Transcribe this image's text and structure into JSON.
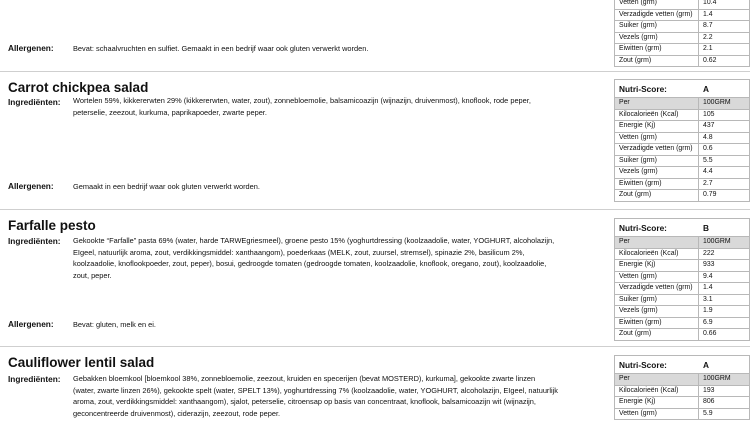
{
  "top_partial": {
    "allergen_label": "Allergenen:",
    "allergen_text": "Bevat: schaalvruchten en sulfiet. Gemaakt in een bedrijf waar ook gluten verwerkt worden.",
    "nutrition_rows": [
      [
        "Vetten (grm)",
        "10.4"
      ],
      [
        "Verzadigde vetten (grm)",
        "1.4"
      ],
      [
        "Suiker (grm)",
        "8.7"
      ],
      [
        "Vezels (grm)",
        "2.2"
      ],
      [
        "Eiwitten (grm)",
        "2.1"
      ],
      [
        "Zout (grm)",
        "0.62"
      ]
    ]
  },
  "products": [
    {
      "title": "Carrot chickpea salad",
      "ingredients_label": "Ingrediënten:",
      "ingredients_lines": [
        "Wortelen 59%, kikkererwten 29% (kikkererwten, water, zout), zonnebloemolie, balsamicoazijn (wijnazijn, druivenmost), knoflook, rode peper,",
        "peterselie, zeezout, kurkuma, paprikapoeder, zwarte peper."
      ],
      "allergen_label": "Allergenen:",
      "allergen_text": "Gemaakt in een bedrijf waar ook gluten verwerkt worden.",
      "nutri_score_label": "Nutri-Score:",
      "nutri_score": "A",
      "nutrition_rows": [
        [
          "Per",
          "100GRM"
        ],
        [
          "Kilocalorieën (Kcal)",
          "105"
        ],
        [
          "Energie (Kj)",
          "437"
        ],
        [
          "Vetten (grm)",
          "4.8"
        ],
        [
          "Verzadigde vetten (grm)",
          "0.6"
        ],
        [
          "Suiker (grm)",
          "5.5"
        ],
        [
          "Vezels (grm)",
          "4.4"
        ],
        [
          "Eiwitten (grm)",
          "2.7"
        ],
        [
          "Zout (grm)",
          "0.79"
        ]
      ]
    },
    {
      "title": "Farfalle pesto",
      "ingredients_label": "Ingrediënten:",
      "ingredients_lines": [
        "Gekookte “Farfalle” pasta 69% (water, harde TARWEgriesmeel), groene pesto 15% (yoghurtdressing (koolzaadolie, water, YOGHURT, alcoholazijn,",
        "EIgeel, natuurlijk aroma, zout, verdikkingsmiddel: xanthaangom), poederkaas (MELK, zout, zuursel, stremsel), spinazie 2%, basilicum 2%,",
        "koolzaadolie, knoflookpoeder, zout, peper), bosui, gedroogde tomaten (gedroogde tomaten, koolzaadolie, knoflook, oregano, zout), koolzaadolie,",
        "zout, peper."
      ],
      "allergen_label": "Allergenen:",
      "allergen_text": "Bevat: gluten, melk en ei.",
      "nutri_score_label": "Nutri-Score:",
      "nutri_score": "B",
      "nutrition_rows": [
        [
          "Per",
          "100GRM"
        ],
        [
          "Kilocalorieën (Kcal)",
          "222"
        ],
        [
          "Energie (Kj)",
          "933"
        ],
        [
          "Vetten (grm)",
          "9.4"
        ],
        [
          "Verzadigde vetten (grm)",
          "1.4"
        ],
        [
          "Suiker (grm)",
          "3.1"
        ],
        [
          "Vezels (grm)",
          "1.9"
        ],
        [
          "Eiwitten (grm)",
          "6.9"
        ],
        [
          "Zout (grm)",
          "0.66"
        ]
      ]
    },
    {
      "title": "Cauliflower lentil salad",
      "ingredients_label": "Ingrediënten:",
      "ingredients_lines": [
        "Gebakken bloemkool [bloemkool 38%, zonnebloemolie, zeezout, kruiden en specerijen (bevat MOSTERD), kurkuma], gekookte zwarte linzen",
        "(water, zwarte linzen 26%), gekookte spelt (water, SPELT 13%), yoghurtdressing 7% (koolzaadolie, water, YOGHURT, alcoholazijn, EIgeel, natuurlijk",
        "aroma, zout, verdikkingsmiddel: xanthaangom), sjalot, peterselie, citroensap op basis van concentraat, knoflook, balsamicoazijn wit (wijnazijn,",
        "geconcentreerde druivenmost), ciderazijn, zeezout, rode peper."
      ],
      "nutri_score_label": "Nutri-Score:",
      "nutri_score": "A",
      "nutrition_rows": [
        [
          "Per",
          "100GRM"
        ],
        [
          "Kilocalorieën (Kcal)",
          "193"
        ],
        [
          "Energie (Kj)",
          "806"
        ],
        [
          "Vetten (grm)",
          "5.9"
        ]
      ]
    }
  ]
}
